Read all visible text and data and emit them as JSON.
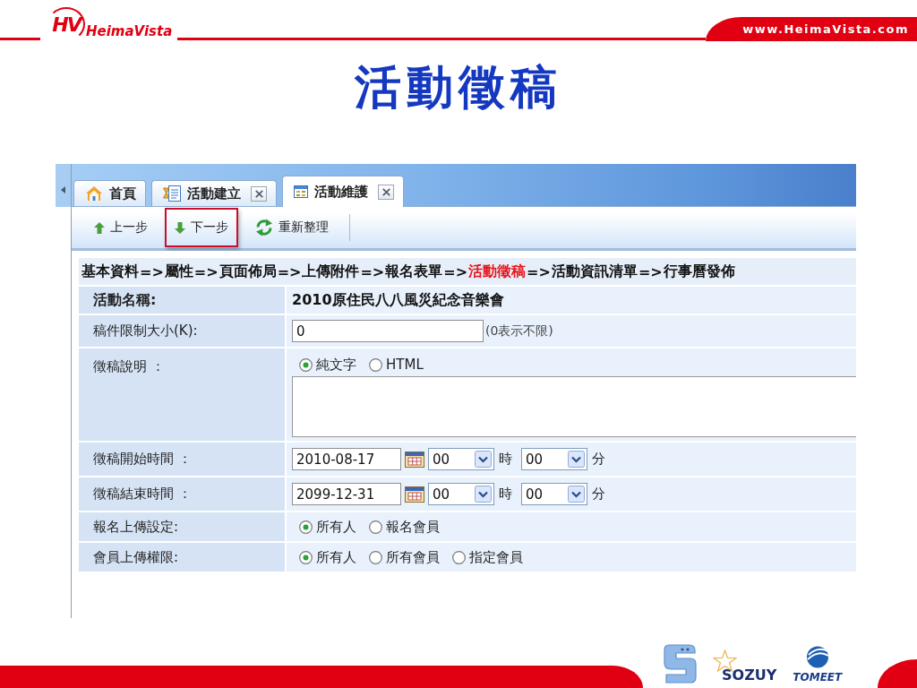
{
  "header": {
    "logo_mark": "HV",
    "logo_text": "HeimaVista",
    "website": "www.HeimaVista.com"
  },
  "title": "活動徵稿",
  "app": {
    "tabs": [
      {
        "label": "首頁",
        "selected": false,
        "closable": false
      },
      {
        "label": "活動建立",
        "selected": false,
        "closable": true
      },
      {
        "label": "活動維護",
        "selected": true,
        "closable": true
      }
    ],
    "toolbar": [
      {
        "label": "上一步",
        "highlighted": false
      },
      {
        "label": "下一步",
        "highlighted": true
      },
      {
        "label": "重新整理",
        "highlighted": false
      }
    ],
    "breadcrumb": {
      "separator": "=>",
      "steps": [
        {
          "label": "基本資料",
          "current": false
        },
        {
          "label": "屬性",
          "current": false
        },
        {
          "label": "頁面佈局",
          "current": false
        },
        {
          "label": "上傳附件",
          "current": false
        },
        {
          "label": "報名表單",
          "current": false
        },
        {
          "label": "活動徵稿",
          "current": true
        },
        {
          "label": "活動資訊清單",
          "current": false
        },
        {
          "label": "行事曆發佈",
          "current": false
        }
      ]
    },
    "form": [
      {
        "kind": "text",
        "label": "活動名稱:",
        "value": "2010原住民八八風災紀念音樂會"
      },
      {
        "kind": "input",
        "label": "稿件限制大小(K):",
        "value": "0",
        "note": "(0表示不限)"
      },
      {
        "kind": "editor",
        "label": "徵稿說明 ：",
        "options": [
          {
            "label": "純文字",
            "selected": true
          },
          {
            "label": "HTML",
            "selected": false
          }
        ]
      },
      {
        "kind": "datetime",
        "label": "徵稿開始時間 ：",
        "date": "2010-08-17",
        "hour": "00",
        "hour_unit": "時",
        "minute": "00",
        "minute_unit": "分"
      },
      {
        "kind": "datetime",
        "label": "徵稿結束時間 ：",
        "date": "2099-12-31",
        "hour": "00",
        "hour_unit": "時",
        "minute": "00",
        "minute_unit": "分"
      },
      {
        "kind": "radio",
        "label": "報名上傳設定:",
        "options": [
          {
            "label": "所有人",
            "selected": true
          },
          {
            "label": "報名會員",
            "selected": false
          }
        ]
      },
      {
        "kind": "radio",
        "label": "會員上傳權限:",
        "options": [
          {
            "label": "所有人",
            "selected": true
          },
          {
            "label": "所有會員",
            "selected": false
          },
          {
            "label": "指定會員",
            "selected": false
          }
        ]
      }
    ]
  },
  "footer": {
    "logos": [
      {
        "kind": "s_mark"
      },
      {
        "kind": "sozuy",
        "text": "SOZUY"
      },
      {
        "kind": "tomeet",
        "text": "TOMEET"
      }
    ]
  }
}
